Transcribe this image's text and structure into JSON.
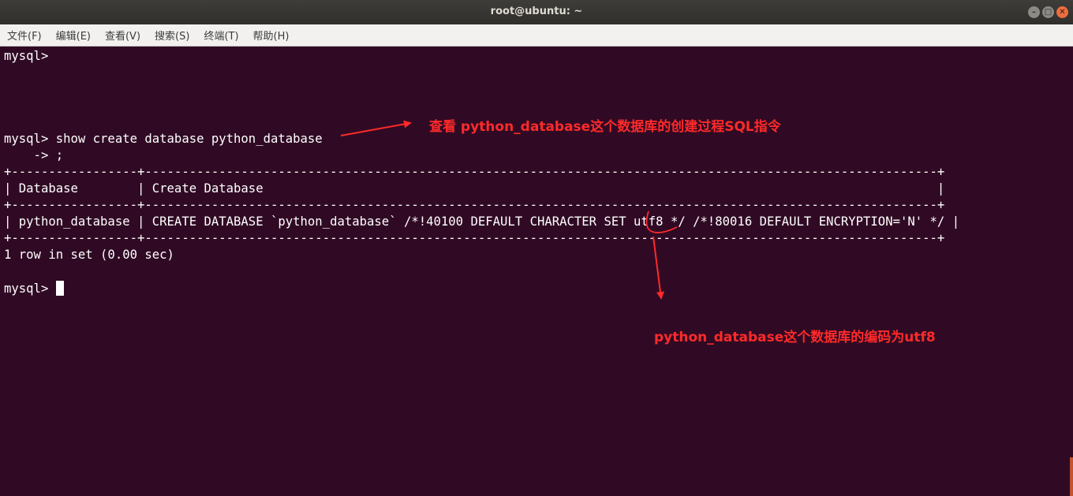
{
  "window": {
    "title": "root@ubuntu: ~",
    "buttons": {
      "minimize": "–",
      "maximize": "□",
      "close": "✕"
    }
  },
  "menu": [
    "文件(F)",
    "编辑(E)",
    "查看(V)",
    "搜索(S)",
    "终端(T)",
    "帮助(H)"
  ],
  "terminal": {
    "lines": [
      "mysql>",
      "mysql> show create database python_database",
      "    -> ;",
      "+-----------------+-----------------------------------------------------------------------------------------------------------+",
      "| Database        | Create Database                                                                                           |",
      "+-----------------+-----------------------------------------------------------------------------------------------------------+",
      "| python_database | CREATE DATABASE `python_database` /*!40100 DEFAULT CHARACTER SET utf8 */ /*!80016 DEFAULT ENCRYPTION='N' */ |",
      "+-----------------+-----------------------------------------------------------------------------------------------------------+",
      "1 row in set (0.00 sec)",
      "mysql> "
    ]
  },
  "annotations": {
    "show_create": "查看 python_database这个数据库的创建过程SQL指令",
    "encoding": "python_database这个数据库的编码为utf8"
  },
  "colors": {
    "terminal_bg": "#300a24",
    "annotation": "#ff2a2a"
  }
}
